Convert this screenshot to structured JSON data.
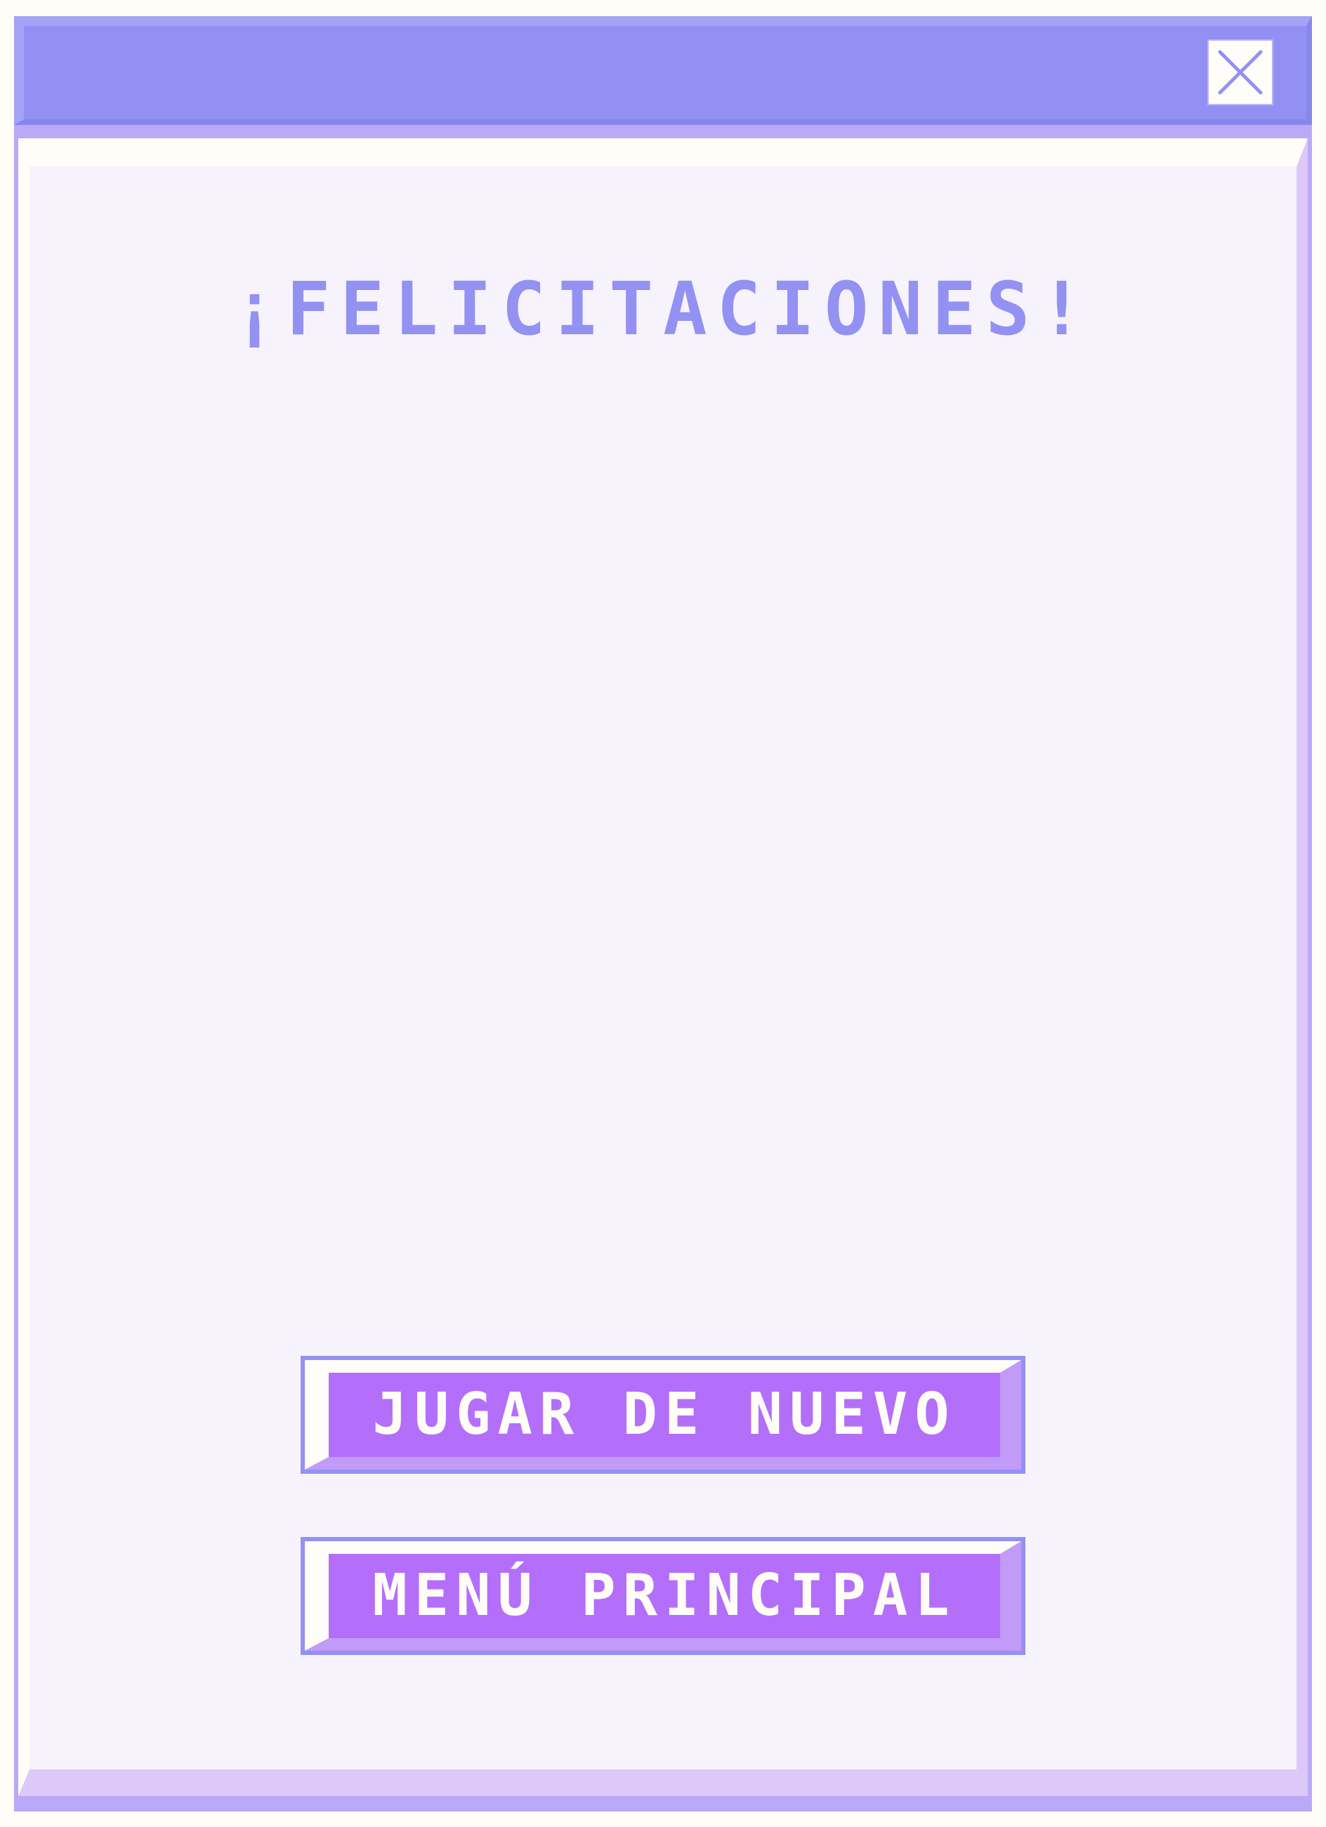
{
  "dialog": {
    "title": "¡FELICITACIONES!",
    "close_icon": "close-icon"
  },
  "buttons": {
    "play_again": "JUGAR DE NUEVO",
    "main_menu": "MENÚ PRINCIPAL"
  },
  "colors": {
    "titlebar": "#9291f3",
    "frame": "#b9a9f7",
    "panel": "#f6f3fd",
    "title_text": "#9391f2",
    "button_face": "#b36ff9",
    "button_text": "#fffdf8"
  }
}
